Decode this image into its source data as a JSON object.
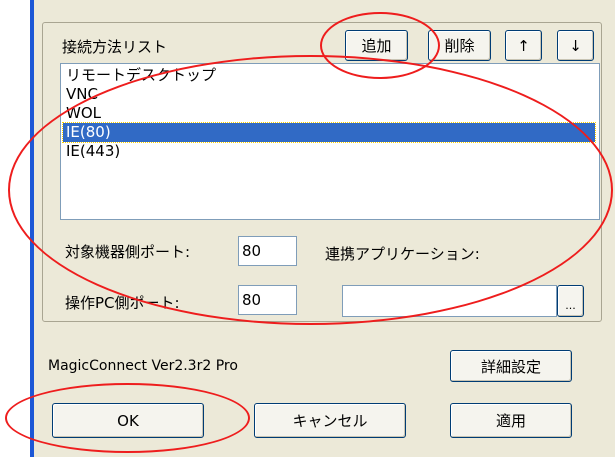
{
  "group": {
    "label": "接続方法リスト"
  },
  "list_buttons": {
    "add": "追加",
    "delete": "削除",
    "up": "↑",
    "down": "↓"
  },
  "connection_list": {
    "items": [
      "リモートデスクトップ",
      "VNC",
      "WOL",
      "IE(80)",
      "IE(443)"
    ],
    "selected_index": 3
  },
  "port_fields": {
    "target_label": "対象機器側ポート:",
    "target_value": "80",
    "operator_label": "操作PC側ポート:",
    "operator_value": "80"
  },
  "app_field": {
    "label": "連携アプリケーション:",
    "value": "",
    "browse": "..."
  },
  "footer": {
    "version": "MagicConnect Ver2.3r2 Pro",
    "advanced": "詳細設定"
  },
  "actions": {
    "ok": "OK",
    "cancel": "キャンセル",
    "apply": "適用"
  },
  "colors": {
    "annotation": "#ee1d1d",
    "selection": "#316ac5",
    "accent": "#1c57d6"
  }
}
